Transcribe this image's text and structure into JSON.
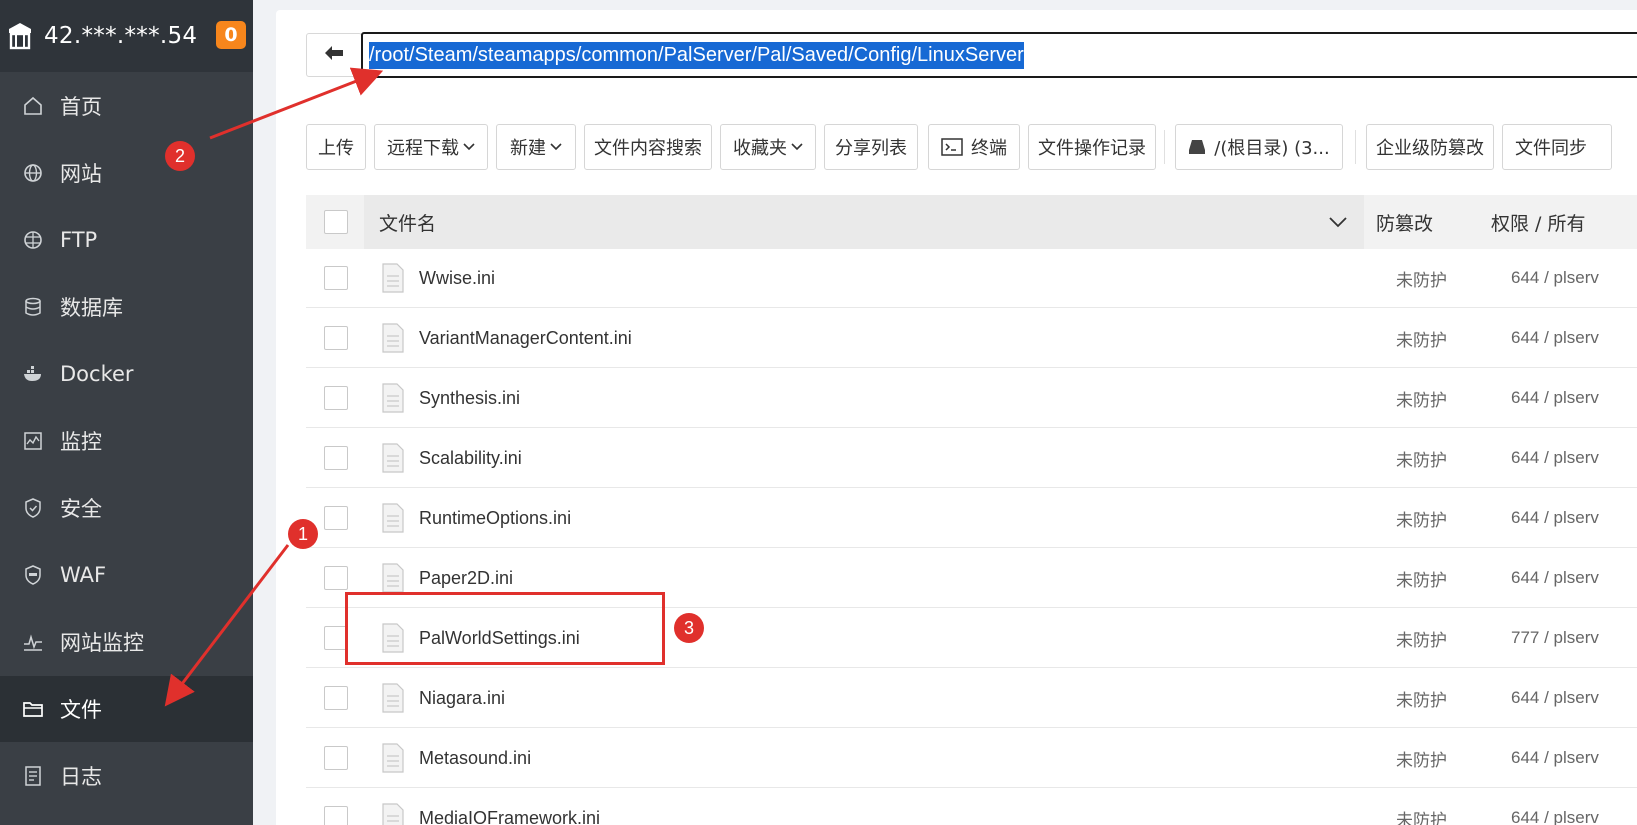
{
  "sidebar": {
    "host": "42.***.***.54",
    "badge": "0",
    "items": [
      {
        "label": "首页",
        "icon": "home-icon"
      },
      {
        "label": "网站",
        "icon": "globe-icon"
      },
      {
        "label": "FTP",
        "icon": "ftp-globe-icon"
      },
      {
        "label": "数据库",
        "icon": "database-icon"
      },
      {
        "label": "Docker",
        "icon": "docker-icon"
      },
      {
        "label": "监控",
        "icon": "monitor-icon"
      },
      {
        "label": "安全",
        "icon": "shield-icon"
      },
      {
        "label": "WAF",
        "icon": "waf-shield-icon"
      },
      {
        "label": "网站监控",
        "icon": "pulse-icon"
      },
      {
        "label": "文件",
        "icon": "folder-icon"
      },
      {
        "label": "日志",
        "icon": "log-icon"
      }
    ],
    "active": "文件"
  },
  "pathbar": {
    "path": "/root/Steam/steamapps/common/PalServer/Pal/Saved/Config/LinuxServer"
  },
  "toolbar": {
    "upload": "上传",
    "remote_download": "远程下载",
    "new": "新建",
    "content_search": "文件内容搜索",
    "favorites": "收藏夹",
    "share_list": "分享列表",
    "terminal": "终端",
    "op_log": "文件操作记录",
    "disk": "/(根目录) (3...",
    "tamper": "企业级防篡改",
    "sync": "文件同步"
  },
  "table": {
    "headers": {
      "name": "文件名",
      "protect": "防篡改",
      "perm": "权限 / 所有"
    },
    "rows": [
      {
        "name": "Wwise.ini",
        "protect": "未防护",
        "perm": "644 / plserv"
      },
      {
        "name": "VariantManagerContent.ini",
        "protect": "未防护",
        "perm": "644 / plserv"
      },
      {
        "name": "Synthesis.ini",
        "protect": "未防护",
        "perm": "644 / plserv"
      },
      {
        "name": "Scalability.ini",
        "protect": "未防护",
        "perm": "644 / plserv"
      },
      {
        "name": "RuntimeOptions.ini",
        "protect": "未防护",
        "perm": "644 / plserv"
      },
      {
        "name": "Paper2D.ini",
        "protect": "未防护",
        "perm": "644 / plserv"
      },
      {
        "name": "PalWorldSettings.ini",
        "protect": "未防护",
        "perm": "777 / plserv"
      },
      {
        "name": "Niagara.ini",
        "protect": "未防护",
        "perm": "644 / plserv"
      },
      {
        "name": "Metasound.ini",
        "protect": "未防护",
        "perm": "644 / plserv"
      },
      {
        "name": "MediaIOFramework.ini",
        "protect": "未防护",
        "perm": "644 / plserv"
      }
    ]
  },
  "annotations": {
    "step1": "1",
    "step2": "2",
    "step3": "3",
    "color": "#e0302c"
  },
  "colors": {
    "sidebar_bg": "#3a3f45",
    "sidebar_active": "#2b3035",
    "badge": "#f7861c",
    "selection": "#1769d4"
  }
}
